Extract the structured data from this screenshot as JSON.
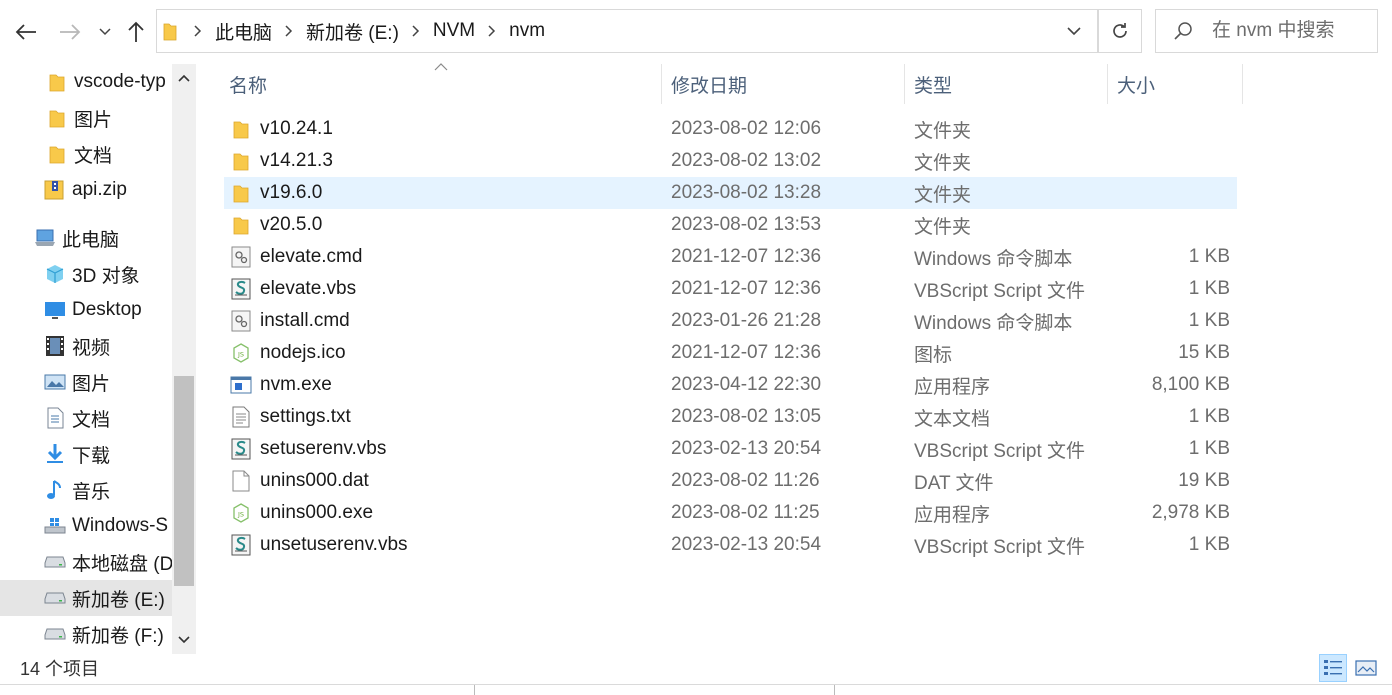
{
  "address": {
    "breadcrumbs": [
      "此电脑",
      "新加卷 (E:)",
      "NVM",
      "nvm"
    ]
  },
  "search": {
    "placeholder": "在 nvm 中搜索"
  },
  "nav_pane": {
    "items": [
      {
        "label": "vscode-typ",
        "icon": "folder-icon"
      },
      {
        "label": "图片",
        "icon": "folder-icon"
      },
      {
        "label": "文档",
        "icon": "folder-icon"
      },
      {
        "label": "api.zip",
        "icon": "zip-icon"
      },
      {
        "label": "此电脑",
        "icon": "this-pc-icon"
      },
      {
        "label": "3D 对象",
        "icon": "3d-objects-icon"
      },
      {
        "label": "Desktop",
        "icon": "desktop-icon"
      },
      {
        "label": "视频",
        "icon": "video-icon"
      },
      {
        "label": "图片",
        "icon": "pictures-icon"
      },
      {
        "label": "文档",
        "icon": "documents-icon"
      },
      {
        "label": "下载",
        "icon": "download-icon"
      },
      {
        "label": "音乐",
        "icon": "music-icon"
      },
      {
        "label": "Windows-S",
        "icon": "windows-drive-icon"
      },
      {
        "label": "本地磁盘 (D",
        "icon": "drive-icon"
      },
      {
        "label": "新加卷 (E:)",
        "icon": "drive-icon",
        "selected": true
      },
      {
        "label": "新加卷 (F:)",
        "icon": "drive-icon"
      }
    ]
  },
  "columns": {
    "name": "名称",
    "date": "修改日期",
    "type": "类型",
    "size": "大小"
  },
  "files": [
    {
      "name": "v10.24.1",
      "date": "2023-08-02 12:06",
      "type": "文件夹",
      "size": "",
      "icon": "folder-icon"
    },
    {
      "name": "v14.21.3",
      "date": "2023-08-02 13:02",
      "type": "文件夹",
      "size": "",
      "icon": "folder-icon"
    },
    {
      "name": "v19.6.0",
      "date": "2023-08-02 13:28",
      "type": "文件夹",
      "size": "",
      "icon": "folder-icon",
      "hover": true
    },
    {
      "name": "v20.5.0",
      "date": "2023-08-02 13:53",
      "type": "文件夹",
      "size": "",
      "icon": "folder-icon"
    },
    {
      "name": "elevate.cmd",
      "date": "2021-12-07 12:36",
      "type": "Windows 命令脚本",
      "size": "1 KB",
      "icon": "cmd-file-icon"
    },
    {
      "name": "elevate.vbs",
      "date": "2021-12-07 12:36",
      "type": "VBScript Script 文件",
      "size": "1 KB",
      "icon": "vbs-file-icon"
    },
    {
      "name": "install.cmd",
      "date": "2023-01-26 21:28",
      "type": "Windows 命令脚本",
      "size": "1 KB",
      "icon": "cmd-file-icon"
    },
    {
      "name": "nodejs.ico",
      "date": "2021-12-07 12:36",
      "type": "图标",
      "size": "15 KB",
      "icon": "nodejs-icon"
    },
    {
      "name": "nvm.exe",
      "date": "2023-04-12 22:30",
      "type": "应用程序",
      "size": "8,100 KB",
      "icon": "exe-icon"
    },
    {
      "name": "settings.txt",
      "date": "2023-08-02 13:05",
      "type": "文本文档",
      "size": "1 KB",
      "icon": "text-file-icon"
    },
    {
      "name": "setuserenv.vbs",
      "date": "2023-02-13 20:54",
      "type": "VBScript Script 文件",
      "size": "1 KB",
      "icon": "vbs-file-icon"
    },
    {
      "name": "unins000.dat",
      "date": "2023-08-02 11:26",
      "type": "DAT 文件",
      "size": "19 KB",
      "icon": "blank-file-icon"
    },
    {
      "name": "unins000.exe",
      "date": "2023-08-02 11:25",
      "type": "应用程序",
      "size": "2,978 KB",
      "icon": "nodejs-icon"
    },
    {
      "name": "unsetuserenv.vbs",
      "date": "2023-02-13 20:54",
      "type": "VBScript Script 文件",
      "size": "1 KB",
      "icon": "vbs-file-icon"
    }
  ],
  "status": {
    "count": "14 个项目"
  },
  "colors": {
    "folder": "#f8c94a",
    "hover": "#e5f3ff",
    "selected_nav": "#e5e5e5",
    "header_text": "#4c607a"
  }
}
